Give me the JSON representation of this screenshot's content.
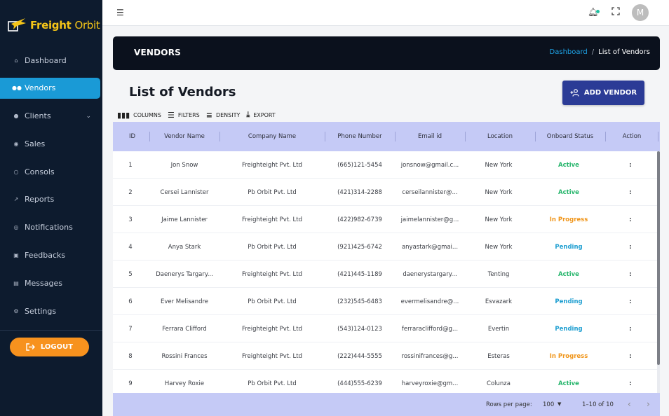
{
  "brand": {
    "name_bold": "Freight",
    "name_rest": "Orbit",
    "logo_icon": "airplane-box-icon"
  },
  "sidebar": {
    "items": [
      {
        "label": "Dashboard",
        "icon": "home-icon"
      },
      {
        "label": "Vendors",
        "icon": "users-icon",
        "active": true
      },
      {
        "label": "Clients",
        "icon": "user-icon",
        "has_submenu": true
      },
      {
        "label": "Sales",
        "icon": "coin-icon"
      },
      {
        "label": "Consols",
        "icon": "sync-icon"
      },
      {
        "label": "Reports",
        "icon": "trend-icon"
      },
      {
        "label": "Notifications",
        "icon": "at-icon"
      },
      {
        "label": "Feedbacks",
        "icon": "feedback-icon"
      },
      {
        "label": "Messages",
        "icon": "message-icon"
      },
      {
        "label": "Settings",
        "icon": "gear-icon"
      }
    ],
    "logout_label": "LOGOUT"
  },
  "topbar": {
    "avatar_initial": "M"
  },
  "banner": {
    "title": "VENDORS",
    "breadcrumb_link": "Dashboard",
    "breadcrumb_sep": "/",
    "breadcrumb_current": "List of Vendors"
  },
  "page": {
    "title": "List of Vendors",
    "add_button": "ADD VENDOR"
  },
  "toolbar": {
    "columns": "COLUMNS",
    "filters": "FILTERS",
    "density": "DENSITY",
    "export": "EXPORT"
  },
  "table": {
    "columns": [
      "ID",
      "Vendor Name",
      "Company Name",
      "Phone Number",
      "Email id",
      "Location",
      "Onboard Status",
      "Action"
    ],
    "rows": [
      {
        "id": "1",
        "vendor": "Jon Snow",
        "company": "Freighteight Pvt. Ltd",
        "phone": "(665)121-5454",
        "email": "jonsnow@gmail.c...",
        "location": "New York",
        "status": "Active",
        "action": ":"
      },
      {
        "id": "2",
        "vendor": "Cersei Lannister",
        "company": "Pb Orbit Pvt. Ltd",
        "phone": "(421)314-2288",
        "email": "cerseilannister@...",
        "location": "New York",
        "status": "Active",
        "action": ":"
      },
      {
        "id": "3",
        "vendor": "Jaime Lannister",
        "company": "Freighteight Pvt. Ltd",
        "phone": "(422)982-6739",
        "email": "jaimelannister@g...",
        "location": "New York",
        "status": "In Progress",
        "action": ":"
      },
      {
        "id": "4",
        "vendor": "Anya Stark",
        "company": "Pb Orbit Pvt. Ltd",
        "phone": "(921)425-6742",
        "email": "anyastark@gmai...",
        "location": "New York",
        "status": "Pending",
        "action": ":"
      },
      {
        "id": "5",
        "vendor": "Daenerys Targary...",
        "company": "Freighteight Pvt. Ltd",
        "phone": "(421)445-1189",
        "email": "daenerystargary...",
        "location": "Tenting",
        "status": "Active",
        "action": ":"
      },
      {
        "id": "6",
        "vendor": "Ever Melisandre",
        "company": "Pb Orbit Pvt. Ltd",
        "phone": "(232)545-6483",
        "email": "evermelisandre@...",
        "location": "Esvazark",
        "status": "Pending",
        "action": ":"
      },
      {
        "id": "7",
        "vendor": "Ferrara Clifford",
        "company": "Freighteight Pvt. Ltd",
        "phone": "(543)124-0123",
        "email": "ferraraclifford@g...",
        "location": "Evertin",
        "status": "Pending",
        "action": ":"
      },
      {
        "id": "8",
        "vendor": "Rossini Frances",
        "company": "Freighteight Pvt. Ltd",
        "phone": "(222)444-5555",
        "email": "rossinifrances@g...",
        "location": "Esteras",
        "status": "In Progress",
        "action": ":"
      },
      {
        "id": "9",
        "vendor": "Harvey Roxie",
        "company": "Pb Orbit Pvt. Ltd",
        "phone": "(444)555-6239",
        "email": "harveyroxie@gm...",
        "location": "Colunza",
        "status": "Active",
        "action": ":"
      }
    ]
  },
  "pagination": {
    "rows_per_page_label": "Rows per page:",
    "rows_per_page": "100",
    "range": "1–10 of 10"
  },
  "colors": {
    "sidebar_bg": "#0d1b2e",
    "active": "#1a9ad6",
    "logout": "#f7921e",
    "primary_button": "#2b3b96",
    "table_header": "#c5caf6",
    "status_active": "#25b56b",
    "status_progress": "#f0961c",
    "status_pending": "#1f9fd1"
  }
}
